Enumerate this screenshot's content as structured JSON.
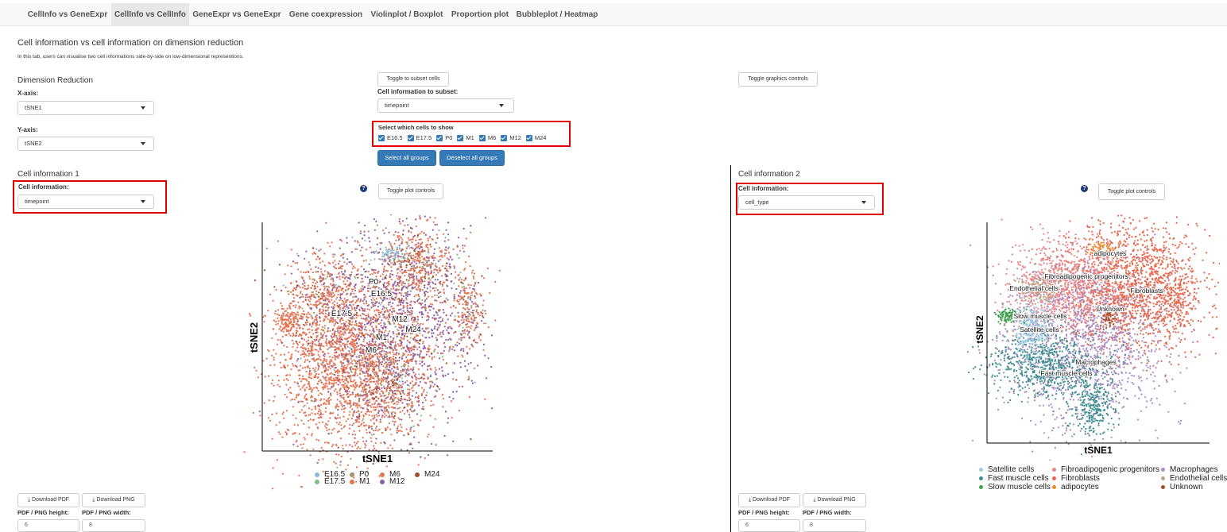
{
  "nav": {
    "tabs": [
      {
        "label": "CellInfo vs GeneExpr",
        "active": false
      },
      {
        "label": "CellInfo vs CellInfo",
        "active": true
      },
      {
        "label": "GeneExpr vs GeneExpr",
        "active": false
      },
      {
        "label": "Gene coexpression",
        "active": false
      },
      {
        "label": "Violinplot / Boxplot",
        "active": false
      },
      {
        "label": "Proportion plot",
        "active": false
      },
      {
        "label": "Bubbleplot / Heatmap",
        "active": false
      }
    ]
  },
  "header": {
    "title": "Cell information vs cell information on dimension reduction",
    "description": "In this tab, users can visualise two cell informations side-by-side on low-dimensional representions."
  },
  "dimred": {
    "title": "Dimension Reduction",
    "x_label": "X-axis:",
    "x_value": "tSNE1",
    "y_label": "Y-axis:",
    "y_value": "tSNE2"
  },
  "subset": {
    "toggle_label": "Toggle to subset cells",
    "info_label": "Cell information to subset:",
    "info_value": "timepoint",
    "which_label": "Select which cells to show",
    "options": [
      "E16.5",
      "E17.5",
      "P0",
      "M1",
      "M6",
      "M12",
      "M24"
    ],
    "select_all": "Select all groups",
    "deselect_all": "Deselect all groups"
  },
  "graphics": {
    "toggle_label": "Toggle graphics controls"
  },
  "panel1": {
    "title": "Cell information 1",
    "info_label": "Cell information:",
    "info_value": "timepoint",
    "help": "?",
    "toggle_plot": "Toggle plot controls",
    "download_pdf": "Download PDF",
    "download_png": "Download PNG",
    "height_label": "PDF / PNG height:",
    "width_label": "PDF / PNG width:",
    "height_value": "6",
    "width_value": "8"
  },
  "panel2": {
    "title": "Cell information 2",
    "info_label": "Cell information:",
    "info_value": "cell_type",
    "help": "?",
    "toggle_plot": "Toggle plot controls",
    "download_pdf": "Download PDF",
    "download_png": "Download PNG",
    "height_label": "PDF / PNG height:",
    "width_label": "PDF / PNG width:",
    "height_value": "6",
    "width_value": "8"
  },
  "plot1": {
    "xlabel": "tSNE1",
    "ylabel": "tSNE2",
    "cluster_labels": [
      "P0",
      "E16.5",
      "E17.5",
      "M12",
      "M24",
      "M1",
      "M6"
    ],
    "legend": [
      {
        "name": "E16.5",
        "color": "#8fb8d6"
      },
      {
        "name": "P0",
        "color": "#a89370"
      },
      {
        "name": "M6",
        "color": "#e07a55"
      },
      {
        "name": "M24",
        "color": "#a0502f"
      },
      {
        "name": "E17.5",
        "color": "#7fbf7f"
      },
      {
        "name": "M1",
        "color": "#e8724f"
      },
      {
        "name": "M12",
        "color": "#8a5fa8"
      }
    ]
  },
  "plot2": {
    "xlabel": "tSNE1",
    "ylabel": "tSNE2",
    "cluster_labels": [
      "adipocytes",
      "Fibroadipogenic progenitors",
      "Endothelial cells",
      "Fibroblasts",
      "Unknown",
      "Slow muscle cells",
      "Satellite cells",
      "Macrophages",
      "Fast muscle cells"
    ],
    "legend": [
      {
        "name": "Satellite cells",
        "color": "#9ecae1"
      },
      {
        "name": "Fibroadipogenic progenitors",
        "color": "#f08080"
      },
      {
        "name": "Macrophages",
        "color": "#a68cc4"
      },
      {
        "name": "Fast muscle cells",
        "color": "#3d8f8f"
      },
      {
        "name": "Fibroblasts",
        "color": "#e8654a"
      },
      {
        "name": "Endothelial cells",
        "color": "#b8a88a"
      },
      {
        "name": "Slow muscle cells",
        "color": "#3fa34d"
      },
      {
        "name": "adipocytes",
        "color": "#f08a24"
      },
      {
        "name": "Unknown",
        "color": "#a0522d"
      }
    ]
  }
}
